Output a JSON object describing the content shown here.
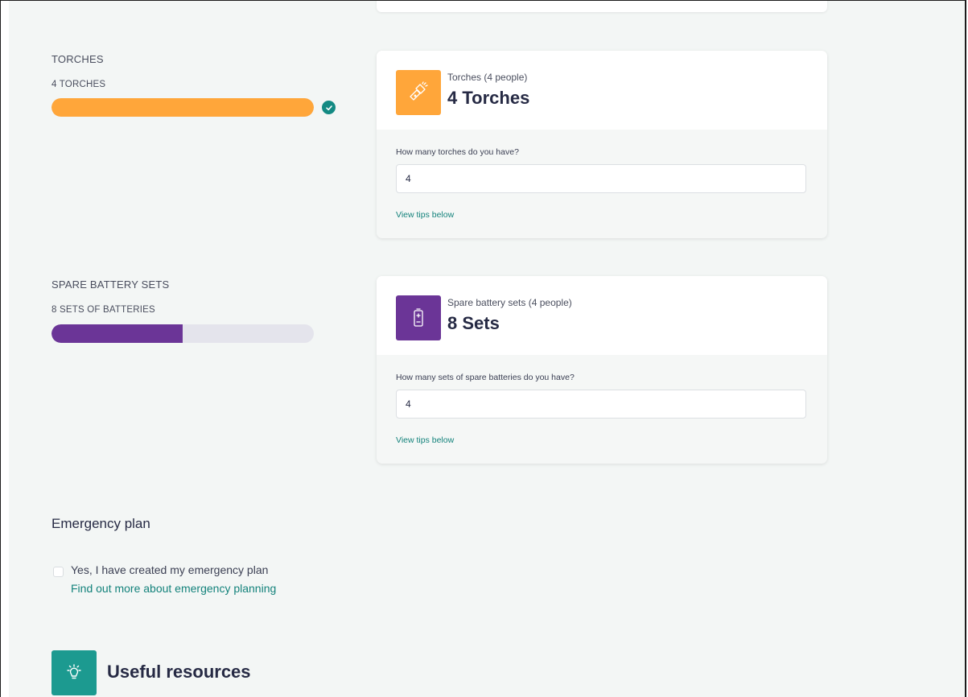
{
  "torches": {
    "label": "TORCHES",
    "sub_label": "4 TORCHES",
    "progress_fraction": 1.0,
    "progress_color": "#ffa63a",
    "complete": true,
    "complete_icon": "check-circle-icon",
    "card": {
      "icon": "flashlight-icon",
      "icon_bg": "#ffa63a",
      "caption": "Torches (4 people)",
      "value": "4 Torches",
      "question": "How many torches do you have?",
      "input_value": "4",
      "tips_link": "View tips below"
    }
  },
  "batteries": {
    "label": "SPARE BATTERY SETS",
    "sub_label": "8 SETS OF BATTERIES",
    "progress_fraction": 0.5,
    "progress_color": "#6b3597",
    "complete": false,
    "card": {
      "icon": "battery-icon",
      "icon_bg": "#6b3597",
      "caption": "Spare battery sets (4 people)",
      "value": "8 Sets",
      "question": "How many sets of spare batteries do you have?",
      "input_value": "4",
      "tips_link": "View tips below"
    }
  },
  "emergency_plan": {
    "title": "Emergency plan",
    "checkbox_label": "Yes, I have created my emergency plan",
    "checked": false,
    "link": "Find out more about emergency planning"
  },
  "resources": {
    "icon": "lightbulb-icon",
    "title": "Useful resources"
  },
  "colors": {
    "accent": "#13827b",
    "page_bg": "#f3f6f5",
    "track": "#e4e4ec"
  }
}
